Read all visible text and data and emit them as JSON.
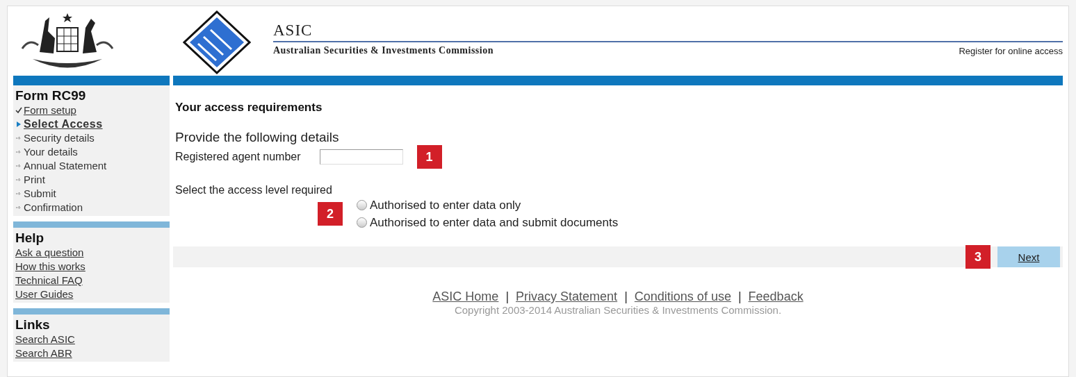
{
  "header": {
    "title": "ASIC",
    "subtitle": "Australian Securities & Investments Commission",
    "register_link": "Register for online access"
  },
  "sidebar": {
    "sections": [
      {
        "title": "Form RC99",
        "items": [
          {
            "label": "Form setup",
            "kind": "done",
            "selected": false
          },
          {
            "label": "Select Access",
            "kind": "current",
            "selected": true
          },
          {
            "label": "Security details",
            "kind": "todo",
            "selected": false
          },
          {
            "label": "Your details",
            "kind": "todo",
            "selected": false
          },
          {
            "label": "Annual Statement",
            "kind": "todo",
            "selected": false
          },
          {
            "label": "Print",
            "kind": "todo",
            "selected": false
          },
          {
            "label": "Submit",
            "kind": "todo",
            "selected": false
          },
          {
            "label": "Confirmation",
            "kind": "todo",
            "selected": false
          }
        ]
      },
      {
        "title": "Help",
        "items": [
          {
            "label": "Ask a question",
            "kind": "link",
            "selected": false
          },
          {
            "label": "How this works",
            "kind": "link",
            "selected": false
          },
          {
            "label": "Technical FAQ",
            "kind": "link",
            "selected": false
          },
          {
            "label": "User Guides",
            "kind": "link",
            "selected": false
          }
        ]
      },
      {
        "title": "Links",
        "items": [
          {
            "label": "Search ASIC",
            "kind": "link",
            "selected": false
          },
          {
            "label": "Search ABR",
            "kind": "link",
            "selected": false
          }
        ]
      }
    ]
  },
  "main": {
    "heading": "Your access requirements",
    "details_label": "Provide the following details",
    "agent_field": {
      "label": "Registered agent number",
      "callout": "1"
    },
    "access_label": "Select the access level required",
    "access_callout": "2",
    "options": [
      {
        "label": "Authorised to enter data only",
        "selected": false
      },
      {
        "label": "Authorised to enter data and submit documents",
        "selected": false
      }
    ],
    "next_callout": "3",
    "next_button": "Next"
  },
  "footer": {
    "links": [
      "ASIC Home",
      "Privacy Statement",
      "Conditions of use",
      "Feedback"
    ],
    "separators": [
      "|",
      "|",
      "|"
    ],
    "copyright": "Copyright 2003-2014 Australian Securities & Investments Commission."
  }
}
